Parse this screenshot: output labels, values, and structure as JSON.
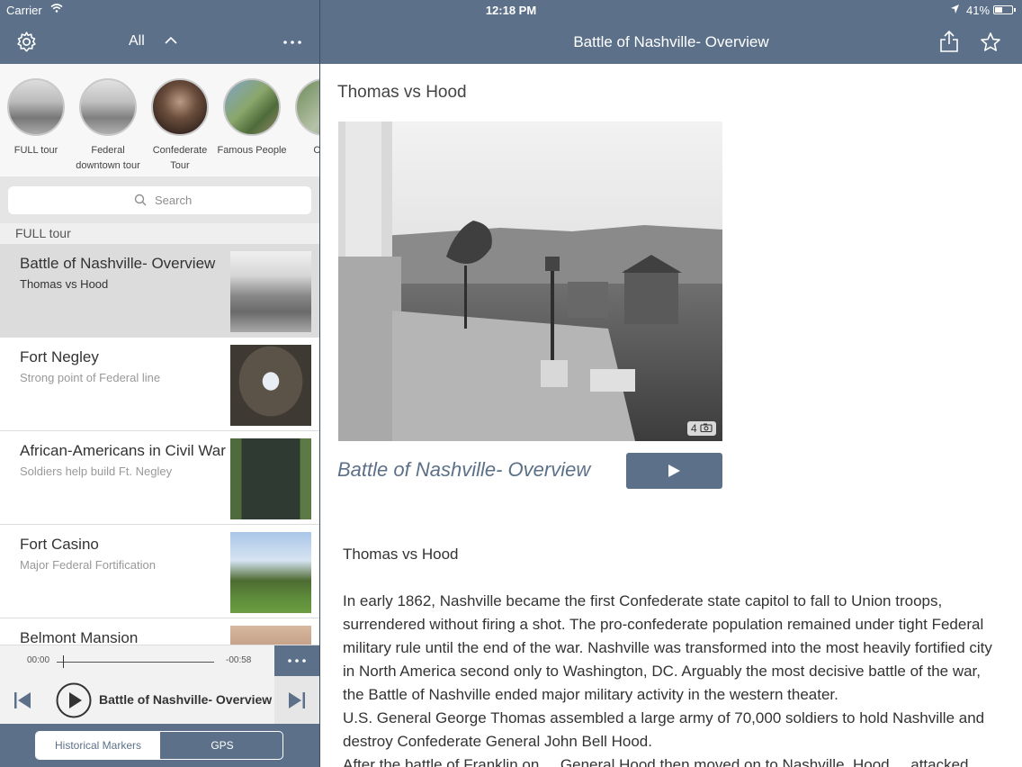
{
  "status": {
    "carrier": "Carrier",
    "time": "12:18 PM",
    "battery": "41%"
  },
  "left_nav": {
    "filter_label": "All"
  },
  "right_nav": {
    "title": "Battle of Nashville- Overview"
  },
  "tours": [
    {
      "name": "FULL tour"
    },
    {
      "name": "Federal downtown tour"
    },
    {
      "name": "Confederate Tour"
    },
    {
      "name": "Famous People"
    },
    {
      "name": "Cem"
    }
  ],
  "search": {
    "placeholder": "Search"
  },
  "section_header": "FULL tour",
  "list": [
    {
      "title": "Battle of Nashville- Overview",
      "subtitle": "Thomas vs Hood",
      "selected": true
    },
    {
      "title": "Fort Negley",
      "subtitle": "Strong point of Federal line"
    },
    {
      "title": "African-Americans in Civil War",
      "subtitle": "Soldiers help build Ft. Negley"
    },
    {
      "title": "Fort Casino",
      "subtitle": "Major Federal Fortification"
    },
    {
      "title": "Belmont Mansion",
      "subtitle": ""
    }
  ],
  "player": {
    "elapsed": "00:00",
    "remaining": "-00:58",
    "track_title": "Battle of Nashville- Overview"
  },
  "bottom_tabs": {
    "markers": "Historical Markers",
    "gps": "GPS"
  },
  "content": {
    "subtitle": "Thomas vs Hood",
    "photo_count": "4",
    "caption_title": "Battle of Nashville- Overview",
    "body_heading": "Thomas vs Hood",
    "body_paragraph_1": "In early 1862, Nashville became the first Confederate state capitol to fall to Union troops, surrendered without firing a shot.  The pro-confederate population remained under tight Federal military rule until the end of the war. Nashville was transformed into the most heavily fortified city in North America second only to Washington, DC.  Arguably the most decisive battle of the war, the Battle of Nashville ended major military activity in the western theater.",
    "body_paragraph_2": "U.S. General George Thomas assembled  a large army of 70,000 soldiers to hold Nashville and destroy Confederate General John Bell Hood.",
    "body_paragraph_3": "After the battle of Franklin on ... General Hood then moved on to Nashville. Hood ... attacked ..."
  },
  "colors": {
    "nav_bg": "#5c7189",
    "accent": "#5c7189"
  }
}
